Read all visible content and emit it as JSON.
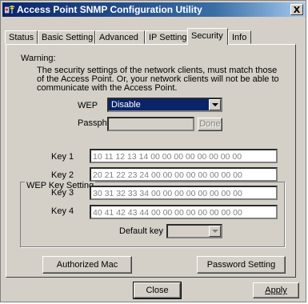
{
  "window": {
    "title": "Access Point SNMP Configuration Utility",
    "close_glyph": "X",
    "icon": "antenna-app-icon"
  },
  "tabs": [
    {
      "label": "Status",
      "active": false
    },
    {
      "label": "Basic Setting",
      "active": false
    },
    {
      "label": "Advanced",
      "active": false
    },
    {
      "label": "IP Setting",
      "active": false
    },
    {
      "label": "Security",
      "active": true
    },
    {
      "label": "Info",
      "active": false
    }
  ],
  "warning": {
    "title": "Warning:",
    "line1": "The security settings of the network clients, must match those",
    "line2": "of the Access Point. Or, your network clients will not be able to",
    "line3": "communicate with the Access Point."
  },
  "wep": {
    "label": "WEP",
    "selected": "Disable",
    "passphrase_label": "Passphrase",
    "passphrase_value": "",
    "done_label": "Done"
  },
  "key_setting": {
    "group_label": "WEP Key Setting",
    "keys": [
      {
        "label": "Key 1",
        "value": "10 11 12 13 14 00 00 00 00 00 00 00 00"
      },
      {
        "label": "Key 2",
        "value": "20 21 22 23 24 00 00 00 00 00 00 00 00"
      },
      {
        "label": "Key 3",
        "value": "30 31 32 33 34 00 00 00 00 00 00 00 00"
      },
      {
        "label": "Key 4",
        "value": "40 41 42 43 44 00 00 00 00 00 00 00 00"
      }
    ],
    "default_key_label": "Default key",
    "default_key_value": ""
  },
  "buttons": {
    "authorized_mac": "Authorized Mac",
    "password_setting": "Password Setting",
    "close": "Close",
    "apply": "Apply"
  },
  "colors": {
    "face": "#d4d0c8",
    "title_start": "#0a246a",
    "title_end": "#a6caf0",
    "selection": "#0a246a",
    "disabled_text": "#808080"
  }
}
